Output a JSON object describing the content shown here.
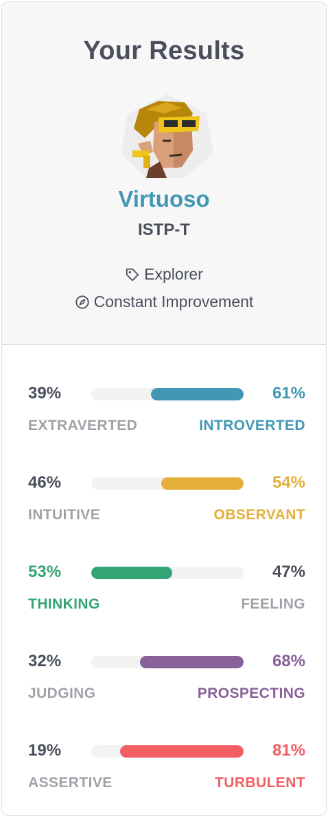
{
  "header": {
    "title": "Your Results",
    "type_name": "Virtuoso",
    "type_code": "ISTP-T",
    "role": "Explorer",
    "strategy": "Constant Improvement"
  },
  "colors": {
    "accent_blue": "#4298b4",
    "accent_yellow": "#e4ae3a",
    "accent_green": "#33a474",
    "accent_purple": "#88619a",
    "accent_red": "#f25e62"
  },
  "traits": [
    {
      "left_pct": "39%",
      "right_pct": "61%",
      "left_label": "EXTRAVERTED",
      "right_label": "INTROVERTED",
      "dominant": "right",
      "fill_fraction": 0.61,
      "color": "#4298b4"
    },
    {
      "left_pct": "46%",
      "right_pct": "54%",
      "left_label": "INTUITIVE",
      "right_label": "OBSERVANT",
      "dominant": "right",
      "fill_fraction": 0.54,
      "color": "#e4ae3a"
    },
    {
      "left_pct": "53%",
      "right_pct": "47%",
      "left_label": "THINKING",
      "right_label": "FEELING",
      "dominant": "left",
      "fill_fraction": 0.53,
      "color": "#33a474"
    },
    {
      "left_pct": "32%",
      "right_pct": "68%",
      "left_label": "JUDGING",
      "right_label": "PROSPECTING",
      "dominant": "right",
      "fill_fraction": 0.68,
      "color": "#88619a"
    },
    {
      "left_pct": "19%",
      "right_pct": "81%",
      "left_label": "ASSERTIVE",
      "right_label": "TURBULENT",
      "dominant": "right",
      "fill_fraction": 0.81,
      "color": "#f25e62"
    }
  ]
}
